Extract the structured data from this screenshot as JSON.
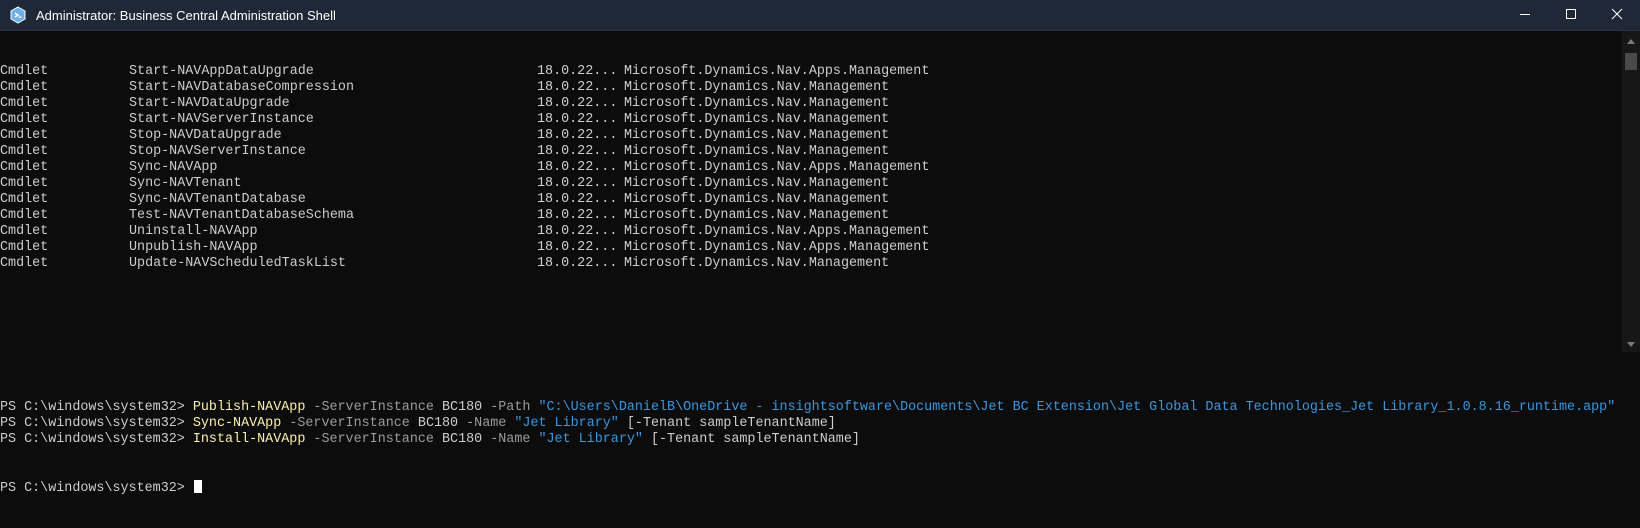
{
  "window": {
    "title": "Administrator: Business Central Administration Shell"
  },
  "table": {
    "rows": [
      {
        "type": "Cmdlet",
        "name": "Start-NAVAppDataUpgrade",
        "version": "18.0.22...",
        "source": "Microsoft.Dynamics.Nav.Apps.Management"
      },
      {
        "type": "Cmdlet",
        "name": "Start-NAVDatabaseCompression",
        "version": "18.0.22...",
        "source": "Microsoft.Dynamics.Nav.Management"
      },
      {
        "type": "Cmdlet",
        "name": "Start-NAVDataUpgrade",
        "version": "18.0.22...",
        "source": "Microsoft.Dynamics.Nav.Management"
      },
      {
        "type": "Cmdlet",
        "name": "Start-NAVServerInstance",
        "version": "18.0.22...",
        "source": "Microsoft.Dynamics.Nav.Management"
      },
      {
        "type": "Cmdlet",
        "name": "Stop-NAVDataUpgrade",
        "version": "18.0.22...",
        "source": "Microsoft.Dynamics.Nav.Management"
      },
      {
        "type": "Cmdlet",
        "name": "Stop-NAVServerInstance",
        "version": "18.0.22...",
        "source": "Microsoft.Dynamics.Nav.Management"
      },
      {
        "type": "Cmdlet",
        "name": "Sync-NAVApp",
        "version": "18.0.22...",
        "source": "Microsoft.Dynamics.Nav.Apps.Management"
      },
      {
        "type": "Cmdlet",
        "name": "Sync-NAVTenant",
        "version": "18.0.22...",
        "source": "Microsoft.Dynamics.Nav.Management"
      },
      {
        "type": "Cmdlet",
        "name": "Sync-NAVTenantDatabase",
        "version": "18.0.22...",
        "source": "Microsoft.Dynamics.Nav.Management"
      },
      {
        "type": "Cmdlet",
        "name": "Test-NAVTenantDatabaseSchema",
        "version": "18.0.22...",
        "source": "Microsoft.Dynamics.Nav.Management"
      },
      {
        "type": "Cmdlet",
        "name": "Uninstall-NAVApp",
        "version": "18.0.22...",
        "source": "Microsoft.Dynamics.Nav.Apps.Management"
      },
      {
        "type": "Cmdlet",
        "name": "Unpublish-NAVApp",
        "version": "18.0.22...",
        "source": "Microsoft.Dynamics.Nav.Apps.Management"
      },
      {
        "type": "Cmdlet",
        "name": "Update-NAVScheduledTaskList",
        "version": "18.0.22...",
        "source": "Microsoft.Dynamics.Nav.Management"
      }
    ]
  },
  "prompt": "PS C:\\windows\\system32> ",
  "commands": [
    {
      "cmd": "Publish-NAVApp",
      "p1": "-ServerInstance",
      "v1": "BC180",
      "p2": "-Path",
      "v2": "\"C:\\Users\\DanielB\\OneDrive - insightsoftware\\Documents\\Jet BC Extension\\Jet Global Data Technologies_Jet Library_1.0.8.16_runtime.app\"",
      "tail": ""
    },
    {
      "cmd": "Sync-NAVApp",
      "p1": "-ServerInstance",
      "v1": "BC180",
      "p2": "-Name",
      "v2": "\"Jet Library\"",
      "tail": "[-Tenant sampleTenantName]"
    },
    {
      "cmd": "Install-NAVApp",
      "p1": "-ServerInstance",
      "v1": "BC180",
      "p2": "-Name",
      "v2": "\"Jet Library\"",
      "tail": "[-Tenant sampleTenantName]"
    }
  ],
  "colors": {
    "background": "#0c0c0c",
    "text": "#cccccc",
    "command": "#f9f1a5",
    "parameter": "#9b9b9b",
    "string": "#3a96dd",
    "titlebar": "#1f2837"
  },
  "icons": {
    "app": "powershell-icon",
    "minimize": "minimize-icon",
    "maximize": "maximize-icon",
    "close": "close-icon",
    "scroll_up": "scroll-up-arrow-icon",
    "scroll_down": "scroll-down-arrow-icon"
  }
}
